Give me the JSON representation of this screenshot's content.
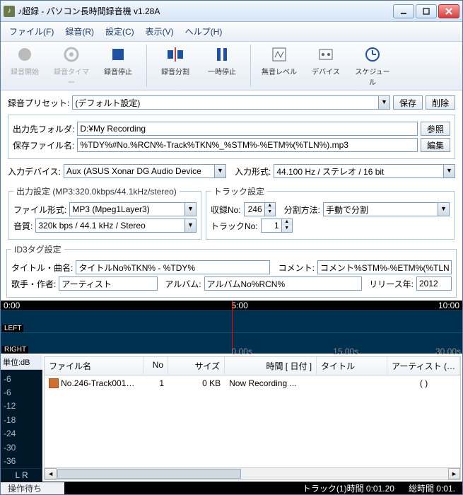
{
  "window": {
    "title": "♪超録 - パソコン長時間録音機 v1.28A"
  },
  "menu": {
    "file": "ファイル(F)",
    "record": "録音(R)",
    "settings": "設定(C)",
    "view": "表示(V)",
    "help": "ヘルプ(H)"
  },
  "toolbar": {
    "rec_start": "録音開始",
    "rec_timer": "録音タイマー",
    "rec_stop": "録音停止",
    "split": "録音分割",
    "pause": "一時停止",
    "silence": "無音レベル",
    "device": "デバイス",
    "schedule": "スケジュール"
  },
  "preset": {
    "label": "録音プリセット:",
    "value": "(デフォルト設定)",
    "save": "保存",
    "delete": "削除"
  },
  "output": {
    "folder_label": "出力先フォルダ:",
    "folder": "D:¥My Recording",
    "browse": "参照",
    "filename_label": "保存ファイル名:",
    "filename": "%TDY%#No.%RCN%-Track%TKN%_%STM%-%ETM%(%TLN%).mp3",
    "edit": "編集"
  },
  "input": {
    "device_label": "入力デバイス:",
    "device": "Aux (ASUS Xonar DG Audio Device",
    "format_label": "入力形式:",
    "format": "44.100 Hz / ステレオ / 16 bit"
  },
  "out_settings": {
    "legend": "出力設定 (MP3:320.0kbps/44.1kHz/stereo)",
    "file_format_label": "ファイル形式:",
    "file_format": "MP3 (Mpeg1Layer3)",
    "quality_label": "音質:",
    "quality": "320k bps / 44.1 kHz / Stereo"
  },
  "track_settings": {
    "legend": "トラック設定",
    "rec_no_label": "収録No:",
    "rec_no": "246",
    "split_label": "分割方法:",
    "split": "手動で分割",
    "track_no_label": "トラックNo:",
    "track_no": "1"
  },
  "id3": {
    "legend": "ID3タグ設定",
    "title_label": "タイトル・曲名:",
    "title": "タイトルNo%TKN% - %TDY%",
    "comment_label": "コメント:",
    "comment": "コメント%STM%-%ETM%(%TLN%)",
    "artist_label": "歌手・作者:",
    "artist": "アーティスト",
    "album_label": "アルバム:",
    "album": "アルバムNo%RCN%",
    "year_label": "リリース年:",
    "year": "2012"
  },
  "waveform": {
    "t0": "0:00",
    "t5": "5:00",
    "t10": "10:00",
    "left": "LEFT",
    "right": "RIGHT",
    "bt0": "0.00s",
    "bt15": "15.00s",
    "bt30": "30.00s"
  },
  "meter": {
    "header": "単位:dB",
    "lr": "L   R",
    "ticks": [
      "-6",
      "-6",
      "-12",
      "-18",
      "-24",
      "-30",
      "-36"
    ]
  },
  "list": {
    "cols": {
      "name": "ファイル名",
      "no": "No",
      "size": "サイズ",
      "time": "時間 [ 日付 ]",
      "title": "タイトル",
      "artist": "アーティスト (…"
    },
    "rows": [
      {
        "name": "No.246-Track001…",
        "no": "1",
        "size": "0 KB",
        "time": "Now Recording ...",
        "title": "",
        "artist": "( )"
      }
    ]
  },
  "status": {
    "wait": "操作待ち",
    "track": "トラック(1)時間 0:01.20",
    "total": "総時間 0:01."
  }
}
